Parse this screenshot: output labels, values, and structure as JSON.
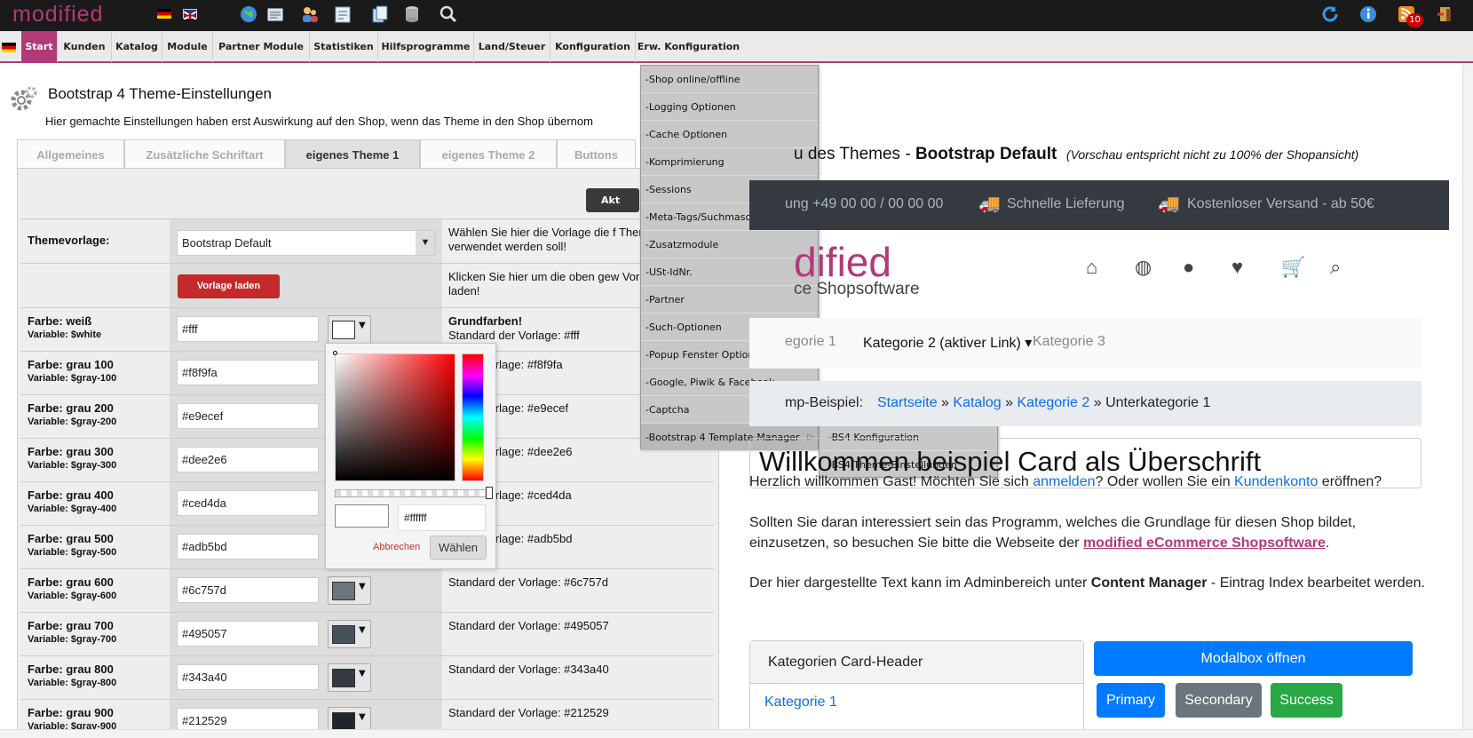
{
  "topbar": {
    "logo": "modified",
    "flags": [
      "de-flag",
      "uk-flag"
    ],
    "icons": [
      "globe-icon",
      "newsletter-icon",
      "customers-icon",
      "orders-icon",
      "copy-icon",
      "database-icon",
      "search-icon"
    ],
    "right_icons": [
      "refresh-icon",
      "info-icon",
      "rss-icon",
      "logout-icon"
    ],
    "rss_badge": "10"
  },
  "menu": {
    "items": [
      "Start",
      "Kunden",
      "Katalog",
      "Module",
      "Partner Module",
      "Statistiken",
      "Hilfsprogramme",
      "Land/Steuer",
      "Konfiguration",
      "Erw. Konfiguration"
    ]
  },
  "dropdown": {
    "items": [
      "-Shop online/offline",
      "-Logging Optionen",
      "-Cache Optionen",
      "-Komprimierung",
      "-Sessions",
      "-Meta-Tags/Suchmaschinen",
      "-Zusatzmodule",
      "-USt-IdNr.",
      "-Partner",
      "-Such-Optionen",
      "-Popup Fenster Optionen",
      "-Google, Piwik & Facebook",
      "-Captcha",
      "-Bootstrap 4 Template-Manager"
    ],
    "submenu": [
      "-BS4 Konfiguration",
      "-BS4 Theme-Einstellungen"
    ]
  },
  "page": {
    "title": "Bootstrap 4 Theme-Einstellungen",
    "note": "Hier gemachte Einstellungen haben erst Auswirkung auf den Shop, wenn das Theme in den Shop übernom",
    "tabs": [
      "Allgemeines",
      "Zusätzliche Schriftart",
      "eigenes Theme 1",
      "eigenes Theme 2",
      "Buttons"
    ],
    "action_button": "Akt"
  },
  "theme_row": {
    "label": "Themevorlage:",
    "value": "Bootstrap Default",
    "desc": "Wählen Sie hier die Vorlage die f Theme verwendet werden soll!"
  },
  "load_row": {
    "button": "Vorlage laden",
    "desc": "Klicken Sie hier um die oben gew Vorlage zu laden!"
  },
  "colors": [
    {
      "label": "Farbe: weiß",
      "var": "Variable: $white",
      "value": "#fff",
      "swatch": "#ffffff",
      "desc_title": "Grundfarben!",
      "desc": "Standard der Vorlage: #fff"
    },
    {
      "label": "Farbe: grau 100",
      "var": "Variable: $gray-100",
      "value": "#f8f9fa",
      "swatch": "#f8f9fa",
      "desc_title": "",
      "desc": "rd der Vorlage: #f8f9fa"
    },
    {
      "label": "Farbe: grau 200",
      "var": "Variable: $gray-200",
      "value": "#e9ecef",
      "swatch": "#e9ecef",
      "desc_title": "",
      "desc": "rd der Vorlage: #e9ecef"
    },
    {
      "label": "Farbe: grau 300",
      "var": "Variable: $gray-300",
      "value": "#dee2e6",
      "swatch": "#dee2e6",
      "desc_title": "",
      "desc": "rd der Vorlage: #dee2e6"
    },
    {
      "label": "Farbe: grau 400",
      "var": "Variable: $gray-400",
      "value": "#ced4da",
      "swatch": "#ced4da",
      "desc_title": "",
      "desc": "rd der Vorlage: #ced4da"
    },
    {
      "label": "Farbe: grau 500",
      "var": "Variable: $gray-500",
      "value": "#adb5bd",
      "swatch": "#adb5bd",
      "desc_title": "",
      "desc": "rd der Vorlage: #adb5bd"
    },
    {
      "label": "Farbe: grau 600",
      "var": "Variable: $gray-600",
      "value": "#6c757d",
      "swatch": "#6c757d",
      "desc_title": "",
      "desc": "Standard der Vorlage: #6c757d"
    },
    {
      "label": "Farbe: grau 700",
      "var": "Variable: $gray-700",
      "value": "#495057",
      "swatch": "#495057",
      "desc_title": "",
      "desc": "Standard der Vorlage: #495057"
    },
    {
      "label": "Farbe: grau 800",
      "var": "Variable: $gray-800",
      "value": "#343a40",
      "swatch": "#343a40",
      "desc_title": "",
      "desc": "Standard der Vorlage: #343a40"
    },
    {
      "label": "Farbe: grau 900",
      "var": "Variable: $gray-900",
      "value": "#212529",
      "swatch": "#212529",
      "desc_title": "",
      "desc": "Standard der Vorlage: #212529"
    }
  ],
  "picker": {
    "hex": "#ffffff",
    "cancel": "Abbrechen",
    "ok": "Wählen"
  },
  "preview": {
    "title_prefix": "u des Themes - ",
    "title_bold": "Bootstrap Default",
    "title_note": "(Vorschau entspricht nicht zu 100% der Shopansicht)",
    "topbar": [
      "ung +49 00 00 / 00 00 00",
      "Schnelle Lieferung",
      "Kostenloser Versand - ab 50€"
    ],
    "logo": "dified",
    "logo_sub": "ce Shopsoftware",
    "nav": [
      "egorie 1",
      "Kategorie 2 (aktiver Link)",
      "Kategorie 3"
    ],
    "breadcrumb_label": "mp-Beispiel:",
    "breadcrumb_links": [
      "Startseite",
      "Katalog",
      "Kategorie 2"
    ],
    "breadcrumb_current": "Unterkategorie 1",
    "card_title": "Willkommen beispiel Card als Überschrift",
    "welcome_a": "Herzlich willkommen Gast! Möchten Sie sich ",
    "welcome_link1": "anmelden",
    "welcome_b": "? Oder wollen Sie ein ",
    "welcome_link2": "Kundenkonto",
    "welcome_c": " eröffnen?",
    "para2_a": "Sollten Sie daran interessiert sein das Programm, welches die Grundlage für diesen Shop bildet, einzusetzen, so besuchen Sie bitte die Webseite der ",
    "para2_link": "modified eCommerce Shopsoftware",
    "para3_a": "Der hier dargestellte Text kann im Adminbereich unter ",
    "para3_bold": "Content Manager",
    "para3_b": " - Eintrag Index bearbeitet werden.",
    "card2_head": "Kategorien Card-Header",
    "card2_item": "Kategorie 1",
    "modal_btn": "Modalbox öffnen",
    "buttons": [
      "Primary",
      "Secondary",
      "Success"
    ]
  },
  "colors_theme": {
    "accent": "#b23a77",
    "danger": "#c42a2a",
    "primary": "#007bff",
    "secondary": "#6c757d",
    "success": "#28a745"
  }
}
